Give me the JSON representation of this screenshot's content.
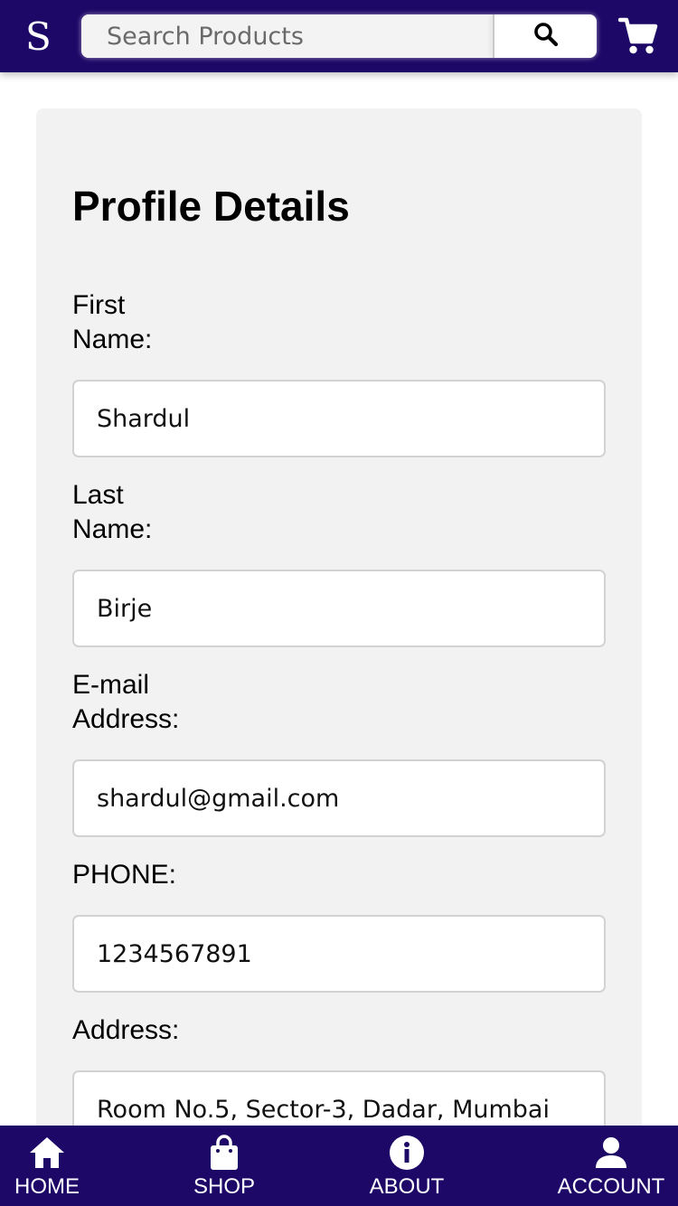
{
  "header": {
    "logo": "S",
    "search": {
      "placeholder": "Search Products",
      "value": ""
    },
    "icons": {
      "search": "search-icon",
      "cart": "cart-icon"
    },
    "colors": {
      "bar": "#1e0867",
      "search_bg": "#f3f3f3"
    }
  },
  "profile": {
    "title": "Profile Details",
    "fields": [
      {
        "label_line1": "First",
        "label_line2": "Name:",
        "value": "Shardul"
      },
      {
        "label_line1": "Last",
        "label_line2": "Name:",
        "value": "Birje"
      },
      {
        "label_line1": "E-mail",
        "label_line2": "Address:",
        "value": "shardul@gmail.com"
      },
      {
        "label": "PHONE:",
        "value": "1234567891"
      },
      {
        "label": "Address:",
        "value": "Room No.5, Sector-3, Dadar, Mumbai"
      }
    ],
    "colors": {
      "card_bg": "#f2f2f2",
      "field_border": "#d2d2d2"
    }
  },
  "nav": {
    "items": [
      {
        "label": "HOME",
        "icon": "home-icon"
      },
      {
        "label": "SHOP",
        "icon": "shopping-bag-icon"
      },
      {
        "label": "ABOUT",
        "icon": "info-icon"
      },
      {
        "label": "ACCOUNT",
        "icon": "person-icon"
      }
    ],
    "colors": {
      "bar": "#1e0867",
      "fg": "#ffffff"
    }
  }
}
